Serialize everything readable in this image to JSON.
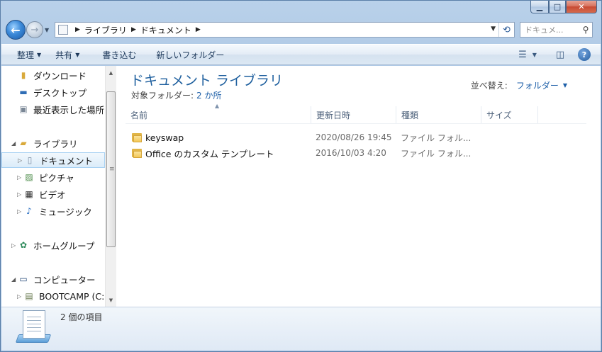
{
  "window": {
    "caption_min": "▁",
    "caption_max": "□",
    "caption_close": "✕"
  },
  "nav": {
    "back_glyph": "←",
    "forward_glyph": "→",
    "breadcrumb": [
      "ライブラリ",
      "ドキュメント"
    ],
    "search_placeholder": "ドキュメ..."
  },
  "toolbar": {
    "organize": "整理",
    "share": "共有",
    "burn": "書き込む",
    "new_folder": "新しいフォルダー"
  },
  "sidebar": {
    "items": [
      {
        "label": "ダウンロード",
        "icon": "download-folder-icon"
      },
      {
        "label": "デスクトップ",
        "icon": "desktop-icon"
      },
      {
        "label": "最近表示した場所",
        "icon": "recent-places-icon"
      },
      {
        "label": "ライブラリ",
        "icon": "libraries-icon"
      },
      {
        "label": "ドキュメント",
        "icon": "documents-icon",
        "selected": true
      },
      {
        "label": "ピクチャ",
        "icon": "pictures-icon"
      },
      {
        "label": "ビデオ",
        "icon": "videos-icon"
      },
      {
        "label": "ミュージック",
        "icon": "music-icon"
      },
      {
        "label": "ホームグループ",
        "icon": "homegroup-icon"
      },
      {
        "label": "コンピューター",
        "icon": "computer-icon"
      },
      {
        "label": "BOOTCAMP (C:",
        "icon": "drive-icon"
      }
    ]
  },
  "library": {
    "title": "ドキュメント ライブラリ",
    "includes_label": "対象フォルダー:",
    "includes_link": "2 か所",
    "arrange_label": "並べ替え:",
    "arrange_value": "フォルダー"
  },
  "columns": {
    "name": "名前",
    "date": "更新日時",
    "type": "種類",
    "size": "サイズ"
  },
  "files": [
    {
      "name": "keyswap",
      "date": "2020/08/26 19:45",
      "type": "ファイル フォル..."
    },
    {
      "name": "Office のカスタム テンプレート",
      "date": "2016/10/03 4:20",
      "type": "ファイル フォル..."
    }
  ],
  "details": {
    "item_count": "2 個の項目"
  },
  "colors": {
    "library_title": "#1e5f9e",
    "link": "#1d5fa8",
    "selection_border": "#a9d2f3"
  }
}
